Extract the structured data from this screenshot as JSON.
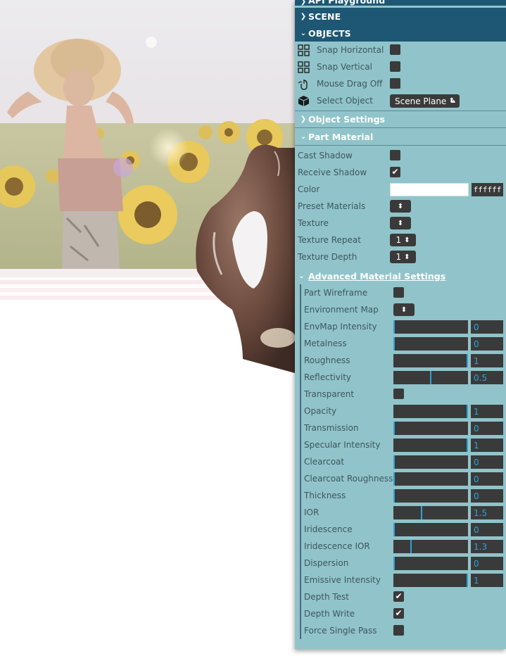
{
  "panel": {
    "folders": {
      "api_playground": "API Playground",
      "scene": "SCENE",
      "objects": "OBJECTS"
    },
    "objects": {
      "snap_horizontal": {
        "label": "Snap Horizontal",
        "checked": false,
        "icon": "grid-icon"
      },
      "snap_vertical": {
        "label": "Snap Vertical",
        "checked": false,
        "icon": "grid-icon"
      },
      "mouse_drag_off": {
        "label": "Mouse Drag Off",
        "checked": false,
        "icon": "mouse-icon"
      },
      "select_object": {
        "label": "Select Object",
        "value": "Scene Plane",
        "icon": "cube-icon"
      }
    },
    "object_settings": "Object Settings",
    "part_material": {
      "title": "Part Material",
      "cast_shadow": {
        "label": "Cast Shadow",
        "checked": false
      },
      "receive_shadow": {
        "label": "Receive Shadow",
        "checked": true
      },
      "color": {
        "label": "Color",
        "value": "ffffff"
      },
      "preset_materials": {
        "label": "Preset Materials"
      },
      "texture": {
        "label": "Texture"
      },
      "texture_repeat": {
        "label": "Texture Repeat",
        "value": "1"
      },
      "texture_depth": {
        "label": "Texture Depth",
        "value": "1"
      }
    },
    "advanced": {
      "title": "Advanced Material Settings",
      "part_wireframe": {
        "label": "Part Wireframe",
        "checked": false
      },
      "environment_map": {
        "label": "Environment Map"
      },
      "sliders": [
        {
          "label": "EnvMap Intensity",
          "value": "0",
          "fraction": 0
        },
        {
          "label": "Metalness",
          "value": "0",
          "fraction": 0
        },
        {
          "label": "Roughness",
          "value": "1",
          "fraction": 1
        },
        {
          "label": "Reflectivity",
          "value": "0.5",
          "fraction": 0.5
        }
      ],
      "transparent": {
        "label": "Transparent",
        "checked": false
      },
      "sliders2": [
        {
          "label": "Opacity",
          "value": "1",
          "fraction": 1
        },
        {
          "label": "Transmission",
          "value": "0",
          "fraction": 0
        },
        {
          "label": "Specular Intensity",
          "value": "1",
          "fraction": 1
        },
        {
          "label": "Clearcoat",
          "value": "0",
          "fraction": 0
        },
        {
          "label": "Clearcoat Roughness",
          "value": "0",
          "fraction": 0
        },
        {
          "label": "Thickness",
          "value": "0",
          "fraction": 0
        },
        {
          "label": "IOR",
          "value": "1.5",
          "fraction": 0.375
        },
        {
          "label": "Iridescence",
          "value": "0",
          "fraction": 0
        },
        {
          "label": "Iridescence IOR",
          "value": "1.3",
          "fraction": 0.233
        },
        {
          "label": "Dispersion",
          "value": "0",
          "fraction": 0
        },
        {
          "label": "Emissive Intensity",
          "value": "1",
          "fraction": 1
        }
      ],
      "depth_test": {
        "label": "Depth Test",
        "checked": true
      },
      "depth_write": {
        "label": "Depth Write",
        "checked": true
      },
      "force_single_pass": {
        "label": "Force Single Pass",
        "checked": false
      }
    }
  },
  "colors": {
    "panel_bg": "#90c4ca",
    "header_bg": "#1e5773",
    "control_bg": "#3a3a3a",
    "accent": "#2fa1d6"
  }
}
